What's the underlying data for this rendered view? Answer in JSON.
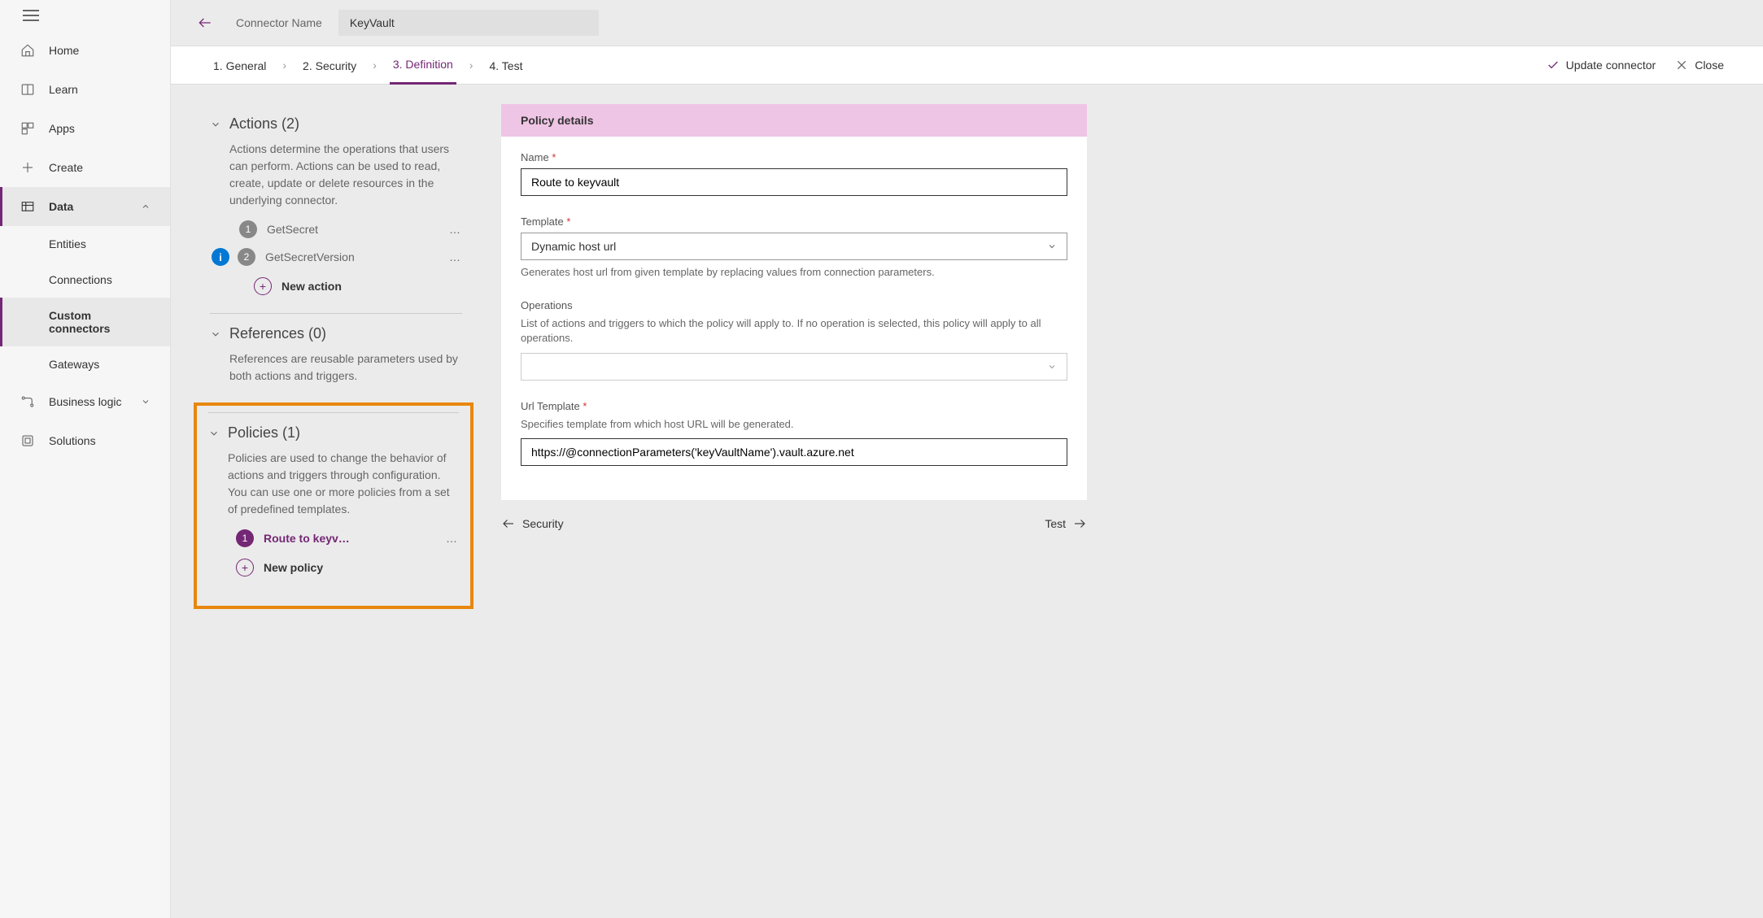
{
  "header": {
    "connector_label": "Connector Name",
    "connector_value": "KeyVault"
  },
  "breadcrumb": {
    "step1": "1. General",
    "step2": "2. Security",
    "step3": "3. Definition",
    "step4": "4. Test",
    "update": "Update connector",
    "close": "Close"
  },
  "sidebar": {
    "home": "Home",
    "learn": "Learn",
    "apps": "Apps",
    "create": "Create",
    "data": "Data",
    "entities": "Entities",
    "connections": "Connections",
    "custom_connectors": "Custom connectors",
    "gateways": "Gateways",
    "business_logic": "Business logic",
    "solutions": "Solutions"
  },
  "left": {
    "actions_title": "Actions (2)",
    "actions_desc": "Actions determine the operations that users can perform. Actions can be used to read, create, update or delete resources in the underlying connector.",
    "action1": "GetSecret",
    "action2": "GetSecretVersion",
    "new_action": "New action",
    "references_title": "References (0)",
    "references_desc": "References are reusable parameters used by both actions and triggers.",
    "policies_title": "Policies (1)",
    "policies_desc": "Policies are used to change the behavior of actions and triggers through configuration. You can use one or more policies from a set of predefined templates.",
    "policy1": "Route to keyv…",
    "new_policy": "New policy"
  },
  "right": {
    "panel_title": "Policy details",
    "name_label": "Name",
    "name_value": "Route to keyvault",
    "template_label": "Template",
    "template_value": "Dynamic host url",
    "template_help": "Generates host url from given template by replacing values from connection parameters.",
    "operations_label": "Operations",
    "operations_help": "List of actions and triggers to which the policy will apply to. If no operation is selected, this policy will apply to all operations.",
    "url_label": "Url Template",
    "url_help": "Specifies template from which host URL will be generated.",
    "url_value": "https://@connectionParameters('keyVaultName').vault.azure.net"
  },
  "footer": {
    "prev": "Security",
    "next": "Test"
  }
}
